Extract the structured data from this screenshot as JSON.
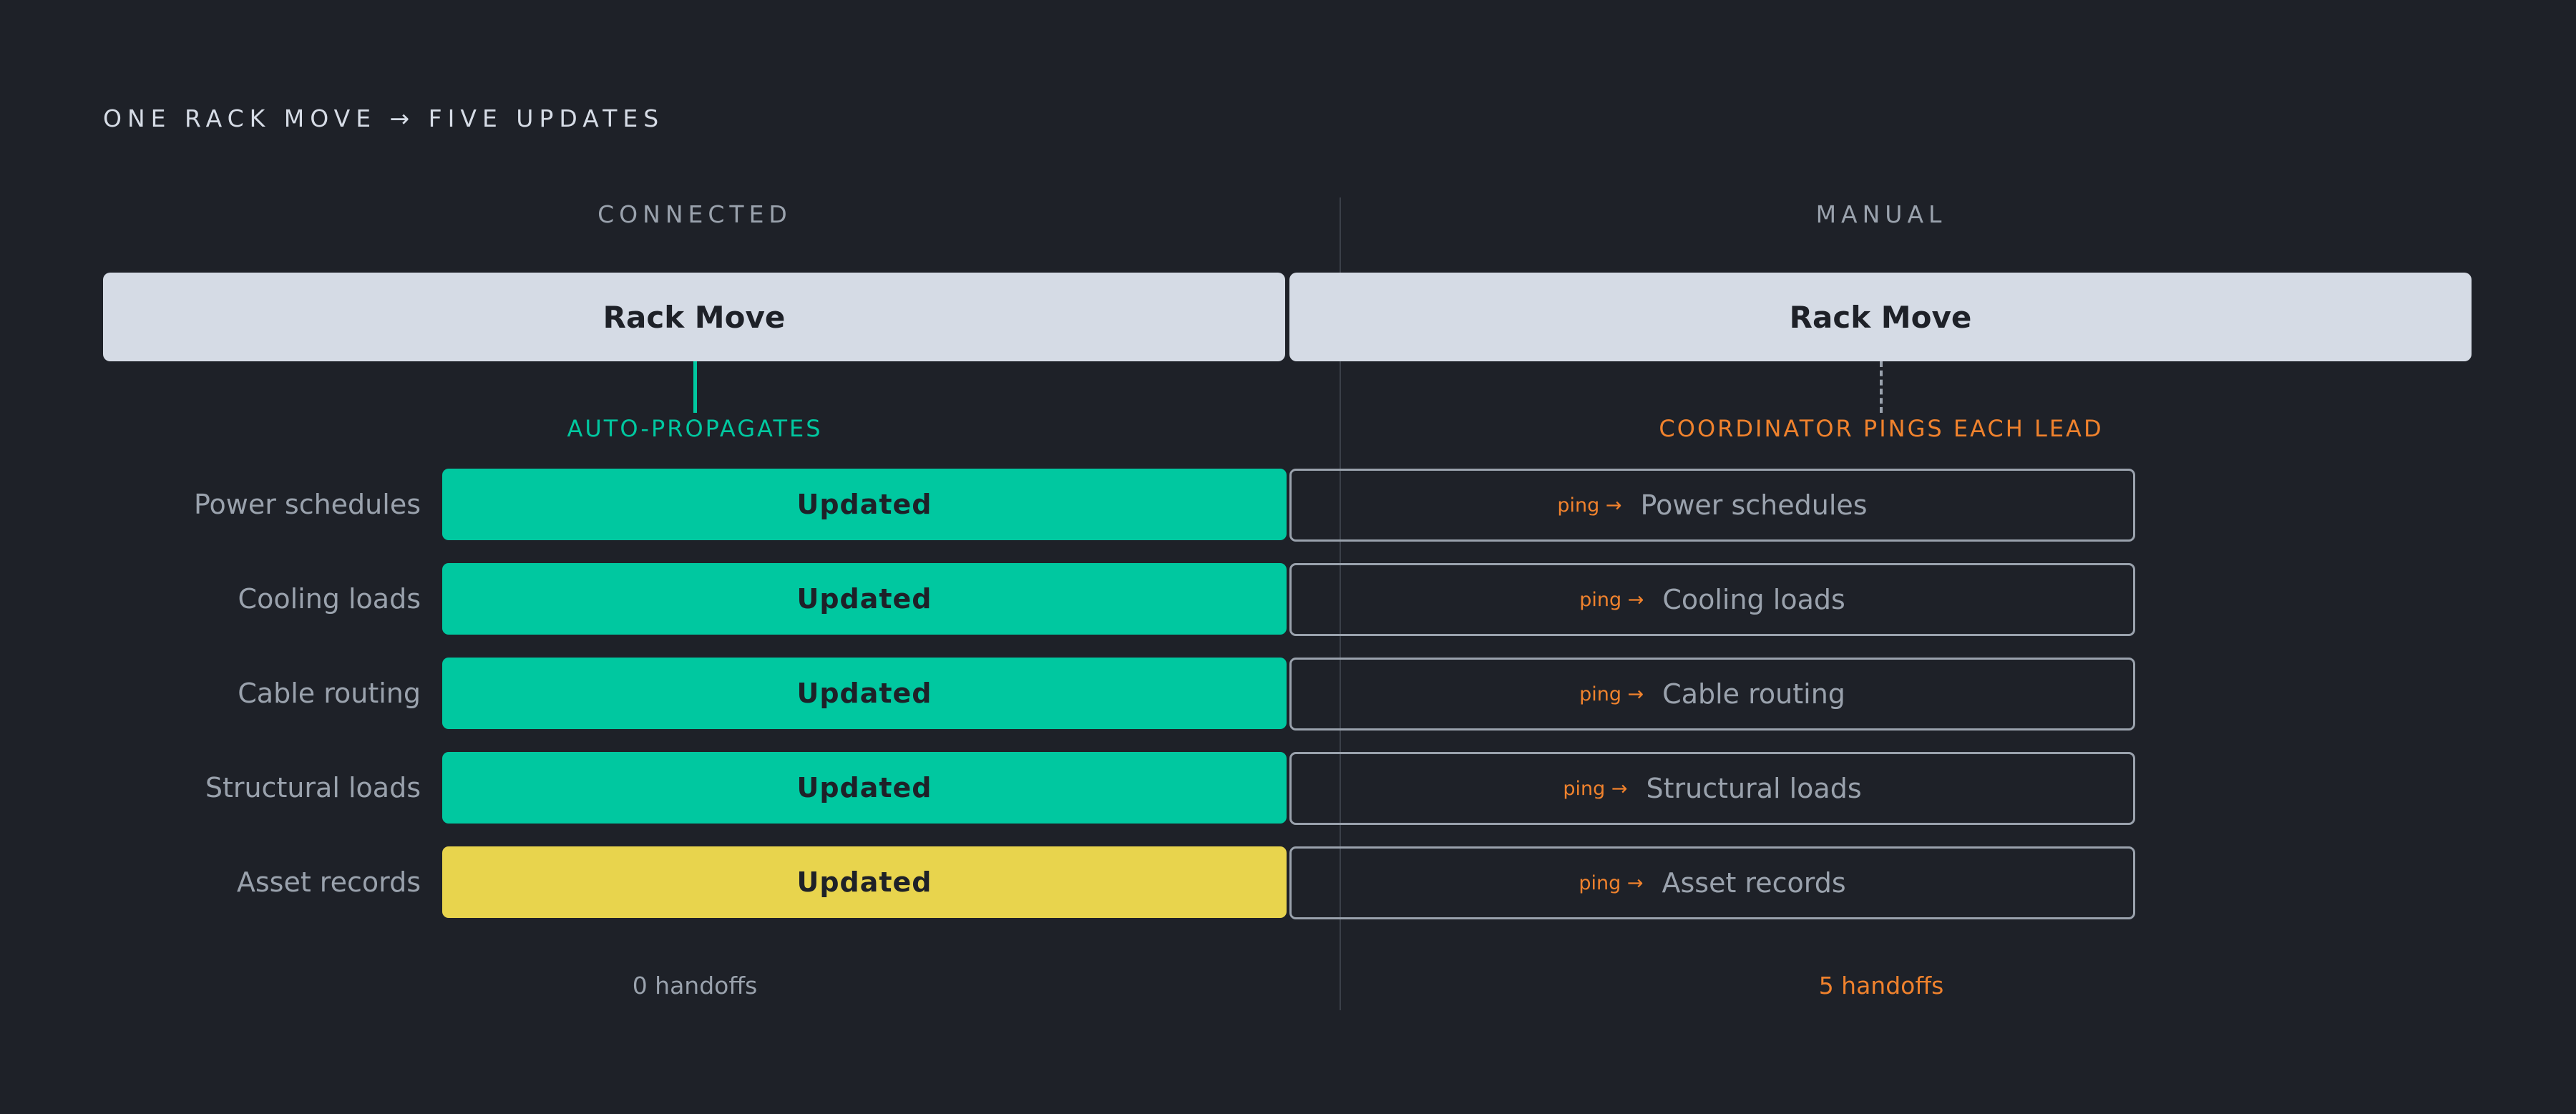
{
  "title": "ONE RACK MOVE → FIVE UPDATES",
  "connected": {
    "heading": "CONNECTED",
    "rack_label": "Rack Move",
    "annotation": "AUTO-PROPAGATES",
    "handoffs": "0 handoffs"
  },
  "manual": {
    "heading": "MANUAL",
    "rack_label": "Rack Move",
    "annotation": "COORDINATOR PINGS EACH LEAD",
    "handoffs": "5 handoffs"
  },
  "rows": [
    {
      "label": "Power schedules",
      "status": "Updated",
      "ping": "ping →",
      "manual_label": "Power schedules",
      "color": "#00c8a0"
    },
    {
      "label": "Cooling loads",
      "status": "Updated",
      "ping": "ping →",
      "manual_label": "Cooling loads",
      "color": "#00c8a0"
    },
    {
      "label": "Cable routing",
      "status": "Updated",
      "ping": "ping →",
      "manual_label": "Cable routing",
      "color": "#00c8a0"
    },
    {
      "label": "Structural loads",
      "status": "Updated",
      "ping": "ping →",
      "manual_label": "Structural loads",
      "color": "#00c8a0"
    },
    {
      "label": "Asset records",
      "status": "Updated",
      "ping": "ping →",
      "manual_label": "Asset records",
      "color": "#e8d44d"
    }
  ]
}
